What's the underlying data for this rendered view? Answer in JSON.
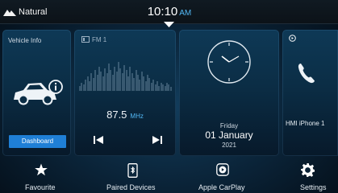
{
  "statusbar": {
    "profile_icon": "mountain-icon",
    "profile_label": "Natural",
    "time": "10:10",
    "ampm": "AM"
  },
  "tiles": {
    "vehicle": {
      "title": "Vehicle Info",
      "icon": "car-info-icon",
      "button": "Dashboard"
    },
    "radio": {
      "band": "FM 1",
      "frequency": "87.5",
      "unit": "MHz",
      "prev_icon": "skip-previous-icon",
      "next_icon": "skip-next-icon"
    },
    "clock": {
      "day": "Friday",
      "date": "01 January",
      "year": "2021"
    },
    "phone": {
      "icon": "phone-icon",
      "device": "HMI iPhone 1"
    }
  },
  "dock": [
    {
      "label": "Favourite",
      "icon": "star-icon"
    },
    {
      "label": "Paired Devices",
      "icon": "phone-bluetooth-icon"
    },
    {
      "label": "Apple CarPlay",
      "icon": "carplay-icon"
    },
    {
      "label": "Settings",
      "icon": "gear-icon"
    }
  ],
  "colors": {
    "accent": "#52b8f5",
    "button": "#1f7fd6"
  }
}
